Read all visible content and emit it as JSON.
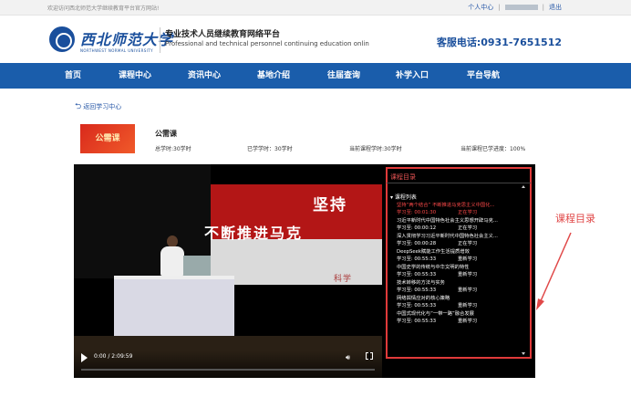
{
  "topbar": {
    "welcome": "欢迎访问西北师范大学继续教育平台官方网站!",
    "user_center": "个人中心",
    "separator": "|",
    "logout": "退出"
  },
  "header": {
    "logo_cn": "西北师范大学",
    "logo_en": "NORTHWEST NORMAL UNIVERSITY",
    "site_title": "专业技术人员继续教育网络平台",
    "site_subtitle": "Professional and technical personnel continuing education onlin",
    "hotline": "客服电话:0931-7651512"
  },
  "nav": {
    "items": [
      {
        "label": "首页"
      },
      {
        "label": "课程中心"
      },
      {
        "label": "资讯中心"
      },
      {
        "label": "基地介绍"
      },
      {
        "label": "往届查询"
      },
      {
        "label": "补学入口"
      },
      {
        "label": "平台导航"
      }
    ]
  },
  "back_link": "返回学习中心",
  "course": {
    "thumb_text": "公需课",
    "title": "公需课",
    "total_hours": "总学时:30学时",
    "learned_hours": "已学学时：30学时",
    "current_course_hours": "当前课程学时:30学时",
    "progress": "当前课程已学进度：100%"
  },
  "video": {
    "slogan_top": "坚持",
    "slogan_bottom": "不断推进马克",
    "screen_text": "科学",
    "time": "0:00 / 2:09:59",
    "progress_fraction": 0
  },
  "catalog": {
    "title": "课程目录",
    "list_header": "课程列表",
    "lessons": [
      {
        "title": "坚持“两个结合” 不断推进马克思主义中国化...",
        "progress": "学习至: 00:01:30",
        "status": "正在学习",
        "active": true
      },
      {
        "title": "习近平新时代中国特色社会主义思想开辟马克...",
        "progress": "学习至: 00:00:12",
        "status": "正在学习",
        "active": false
      },
      {
        "title": "深入贯彻学习习近平新时代中国特色社会主义...",
        "progress": "学习至: 00:00:28",
        "status": "正在学习",
        "active": false
      },
      {
        "title": "DeepSeek赋能工作生活提质增效",
        "progress": "学习至: 00:55:33",
        "status": "重新学习",
        "active": false
      },
      {
        "title": "中国史学的传统与中华文明的特性",
        "progress": "学习至: 00:55:33",
        "status": "重新学习",
        "active": false
      },
      {
        "title": "技术转移的方法与实务",
        "progress": "学习至: 00:55:33",
        "status": "重新学习",
        "active": false
      },
      {
        "title": "网络舆情应对的核心策略",
        "progress": "学习至: 00:55:33",
        "status": "重新学习",
        "active": false
      },
      {
        "title": "中国式现代化与“一带一路”融合发展",
        "progress": "学习至: 00:55:33",
        "status": "重新学习",
        "active": false
      }
    ]
  },
  "annotation": {
    "label": "课程目录",
    "color": "#e04848"
  },
  "colors": {
    "nav_bg": "#1a5dab",
    "brand_blue": "#1a4f9c",
    "highlight_red": "#e03a3a"
  }
}
